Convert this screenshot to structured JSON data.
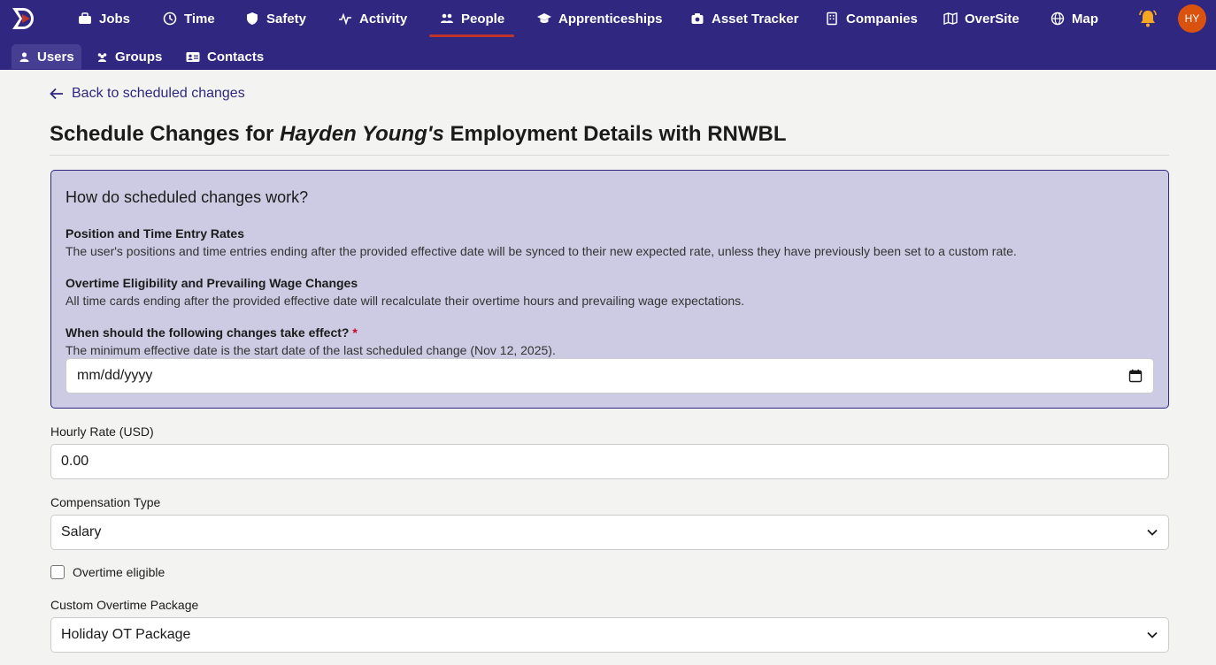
{
  "topnav": {
    "items": [
      {
        "label": "Jobs",
        "icon": "briefcase-icon"
      },
      {
        "label": "Time",
        "icon": "clock-icon"
      },
      {
        "label": "Safety",
        "icon": "shield-icon"
      },
      {
        "label": "Activity",
        "icon": "pulse-icon"
      },
      {
        "label": "People",
        "icon": "people-icon",
        "active": true
      },
      {
        "label": "Apprenticeships",
        "icon": "graduation-cap-icon"
      },
      {
        "label": "Asset Tracker",
        "icon": "camera-icon"
      },
      {
        "label": "Companies",
        "icon": "building-icon"
      },
      {
        "label": "OverSite",
        "icon": "map-fold-icon"
      },
      {
        "label": "Map",
        "icon": "globe-icon"
      }
    ],
    "avatar_initials": "HY",
    "accent_color": "#2f2780",
    "active_indicator_color": "#c0352b"
  },
  "subnav": {
    "items": [
      {
        "label": "Users",
        "icon": "user-icon",
        "active": true
      },
      {
        "label": "Groups",
        "icon": "group-icon"
      },
      {
        "label": "Contacts",
        "icon": "contact-card-icon"
      }
    ]
  },
  "page": {
    "back_label": "Back to scheduled changes",
    "title_prefix": "Schedule Changes for ",
    "title_name": "Hayden Young's",
    "title_suffix": " Employment Details with RNWBL"
  },
  "info": {
    "heading": "How do scheduled changes work?",
    "section1_title": "Position and Time Entry Rates",
    "section1_text": "The user's positions and time entries ending after the provided effective date will be synced to their new expected rate, unless they have previously been set to a custom rate.",
    "section2_title": "Overtime Eligibility and Prevailing Wage Changes",
    "section2_text": "All time cards ending after the provided effective date will recalculate their overtime hours and prevailing wage expectations.",
    "date_label": "When should the following changes take effect?",
    "date_required": "*",
    "date_help": "The minimum effective date is the start date of the last scheduled change (Nov 12, 2025).",
    "date_placeholder": "mm/dd/yyyy"
  },
  "form": {
    "hourly_rate_label": "Hourly Rate (USD)",
    "hourly_rate_value": "0.00",
    "compensation_label": "Compensation Type",
    "compensation_value": "Salary",
    "overtime_label": "Overtime eligible",
    "overtime_checked": false,
    "ot_package_label": "Custom Overtime Package",
    "ot_package_value": "Holiday OT Package"
  }
}
